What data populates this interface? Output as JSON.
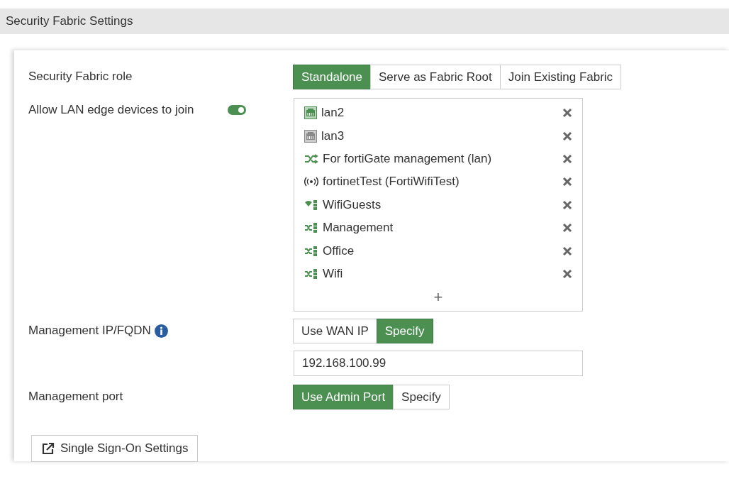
{
  "header": {
    "title": "Security Fabric Settings"
  },
  "role": {
    "label": "Security Fabric role",
    "options": [
      {
        "label": "Standalone",
        "selected": true
      },
      {
        "label": "Serve as Fabric Root",
        "selected": false
      },
      {
        "label": "Join Existing Fabric",
        "selected": false
      }
    ]
  },
  "lan_edge": {
    "label": "Allow LAN edge devices to join",
    "on": true,
    "interfaces": [
      {
        "kind": "port",
        "up": true,
        "name": "lan2"
      },
      {
        "kind": "port",
        "up": false,
        "name": "lan3"
      },
      {
        "kind": "switch",
        "name": "For fortiGate management (lan)"
      },
      {
        "kind": "ssid",
        "name": "fortinetTest (FortiWifiTest)"
      },
      {
        "kind": "wifi-zone",
        "name": "WifiGuests"
      },
      {
        "kind": "zone",
        "name": "Management"
      },
      {
        "kind": "zone",
        "name": "Office"
      },
      {
        "kind": "zone",
        "name": "Wifi"
      }
    ],
    "add": "+"
  },
  "management_ip": {
    "label": "Management IP/FQDN",
    "options": [
      {
        "label": "Use WAN IP",
        "selected": false
      },
      {
        "label": "Specify",
        "selected": true
      }
    ],
    "value": "192.168.100.99"
  },
  "management_port": {
    "label": "Management port",
    "options": [
      {
        "label": "Use Admin Port",
        "selected": true
      },
      {
        "label": "Specify",
        "selected": false
      }
    ]
  },
  "sso_button": "Single Sign-On Settings"
}
